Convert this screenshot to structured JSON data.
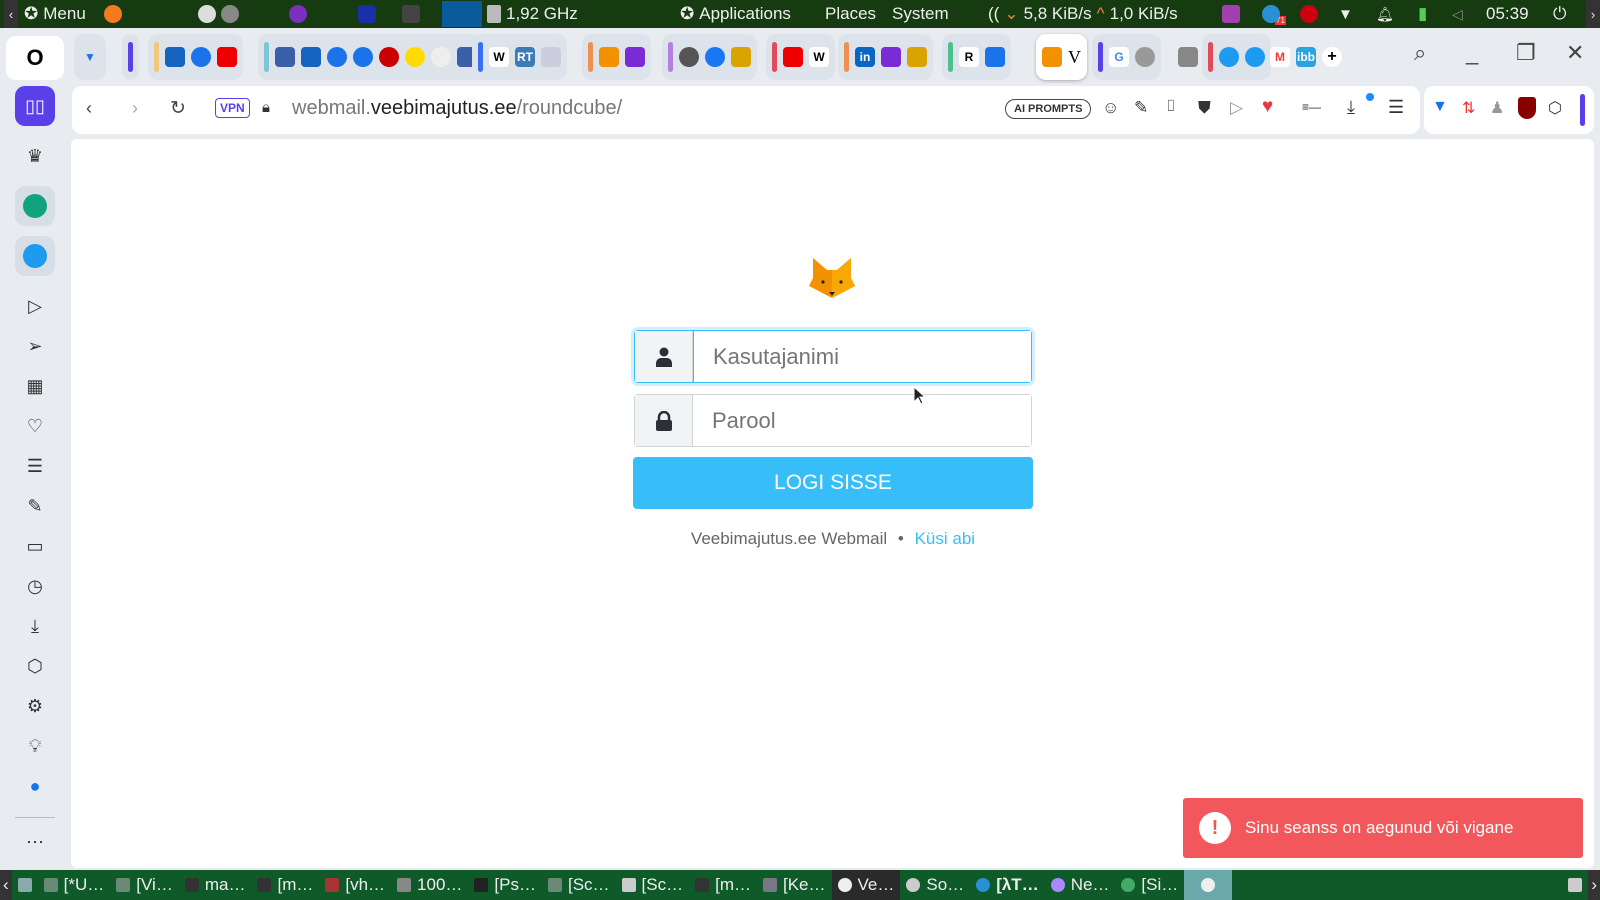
{
  "panel": {
    "menu": "Menu",
    "cpu": "1,92 GHz",
    "applications": "Applications",
    "places": "Places",
    "system": "System",
    "net_down": "5,8 KiB/s",
    "net_up": "1,0 KiB/s",
    "clock": "05:39",
    "badge": "71"
  },
  "tabs": {
    "active_letter": "V"
  },
  "address": {
    "vpn": "VPN",
    "url_pre": "webmail.",
    "url_host": "veebimajutus.ee",
    "url_path": "/roundcube/",
    "ai_prompts": "AI PROMPTS"
  },
  "login": {
    "username_placeholder": "Kasutajanimi",
    "password_placeholder": "Parool",
    "submit": "LOGI SISSE",
    "footer_brand": "Veebimajutus.ee Webmail",
    "footer_sep": "•",
    "help_link": "Küsi abi"
  },
  "toast": {
    "message": "Sinu seanss on aegunud või vigane",
    "icon": "!"
  },
  "taskbar": {
    "items": [
      "[*U…",
      "[Vi…",
      "ma…",
      "[m…",
      "[vh…",
      "100…",
      "[Ps…",
      "[Sc…",
      "[Sc…",
      "[m…",
      "[Ke…",
      "Ve…",
      "So…",
      "[λT…",
      "Ne…",
      "[Si…"
    ]
  },
  "colors": {
    "accent": "#37bef9",
    "toast": "#f2575b",
    "panel": "#163b10",
    "taskbar": "#0f5a29"
  }
}
